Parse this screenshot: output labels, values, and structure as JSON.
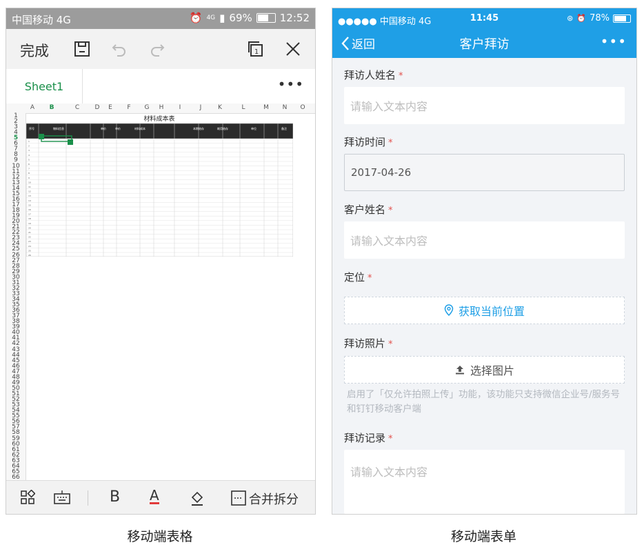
{
  "left_phone": {
    "status": {
      "carrier": "中国移动 4G",
      "battery": "69%",
      "time": "12:52",
      "network": "4G"
    },
    "toolbar": {
      "done_label": "完成"
    },
    "tabs": {
      "sheet_name": "Sheet1",
      "more": "•••"
    },
    "columns": [
      "A",
      "B",
      "C",
      "D",
      "E",
      "F",
      "G",
      "H",
      "I",
      "J",
      "K",
      "L",
      "M",
      "N",
      "O"
    ],
    "active_column": "B",
    "active_row": "5",
    "row_count": 66,
    "table": {
      "title": "材料成本表",
      "headers": [
        "序号",
        "物料信息",
        "单价",
        "单价",
        "材料成本",
        "本期结存",
        "耗用结存",
        "单位",
        "备注"
      ]
    },
    "bottom_toolbar": {
      "bold": "B",
      "font_color": "A",
      "merge_label": "合并拆分"
    }
  },
  "right_phone": {
    "status": {
      "carrier": "●●●●● 中国移动 4G",
      "time": "11:45",
      "battery": "78%"
    },
    "nav": {
      "back_label": "返回",
      "title": "客户拜访",
      "more": "•••"
    },
    "fields": [
      {
        "label": "拜访人姓名",
        "required": "*",
        "placeholder": "请输入文本内容"
      },
      {
        "label": "拜访时间",
        "required": "*",
        "value": "2017-04-26"
      },
      {
        "label": "客户姓名",
        "required": "*",
        "placeholder": "请输入文本内容"
      },
      {
        "label": "定位",
        "required": "*",
        "button": "获取当前位置"
      },
      {
        "label": "拜访照片",
        "required": "*",
        "button": "选择图片",
        "hint": "启用了「仅允许拍照上传」功能，该功能只支持微信企业号/服务号和钉钉移动客户端"
      },
      {
        "label": "拜访记录",
        "required": "*",
        "placeholder": "请输入文本内容"
      }
    ]
  },
  "captions": {
    "left": "移动端表格",
    "right": "移动端表单"
  },
  "colors": {
    "brand_blue": "#1f9fe6",
    "sheet_green": "#1a8f4a",
    "required_red": "#e2534e"
  }
}
